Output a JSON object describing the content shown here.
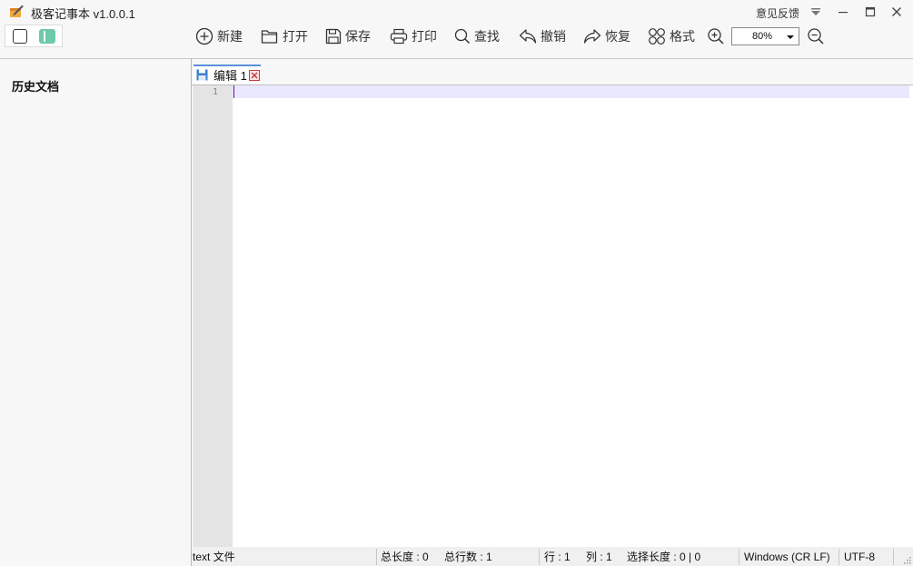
{
  "window": {
    "title": "极客记事本 v1.0.0.1",
    "feedback_label": "意见反馈"
  },
  "toolbar": {
    "new_label": "新建",
    "open_label": "打开",
    "save_label": "保存",
    "print_label": "打印",
    "find_label": "查找",
    "undo_label": "撤销",
    "redo_label": "恢复",
    "format_label": "格式",
    "zoom_value": "80%"
  },
  "sidebar": {
    "title": "历史文档"
  },
  "editor": {
    "tab_label": "编辑 1",
    "line_numbers": [
      "1"
    ]
  },
  "statusbar": {
    "file_type": "text 文件",
    "total_length": "总长度 : 0",
    "total_lines": "总行数 : 1",
    "row": "行 : 1",
    "col": "列 : 1",
    "selection": "选择长度 : 0 | 0",
    "line_ending": "Windows (CR LF)",
    "encoding": "UTF-8"
  },
  "colors": {
    "accent_green": "#6ec9a9",
    "tab_accent": "#5a8fd8",
    "current_line": "#e8e8ff",
    "caret": "#7a0aa8"
  },
  "icons": [
    "app-logo-icon",
    "layout-single-icon",
    "layout-split-icon",
    "plus-circle-icon",
    "folder-icon",
    "floppy-icon",
    "printer-icon",
    "search-icon",
    "undo-icon",
    "redo-icon",
    "grid-icon",
    "zoom-in-icon",
    "zoom-out-icon",
    "tab-save-icon",
    "tab-close-icon",
    "dropdown-triangle-icon",
    "minimize-icon",
    "maximize-icon",
    "close-icon",
    "resize-grip-icon"
  ]
}
